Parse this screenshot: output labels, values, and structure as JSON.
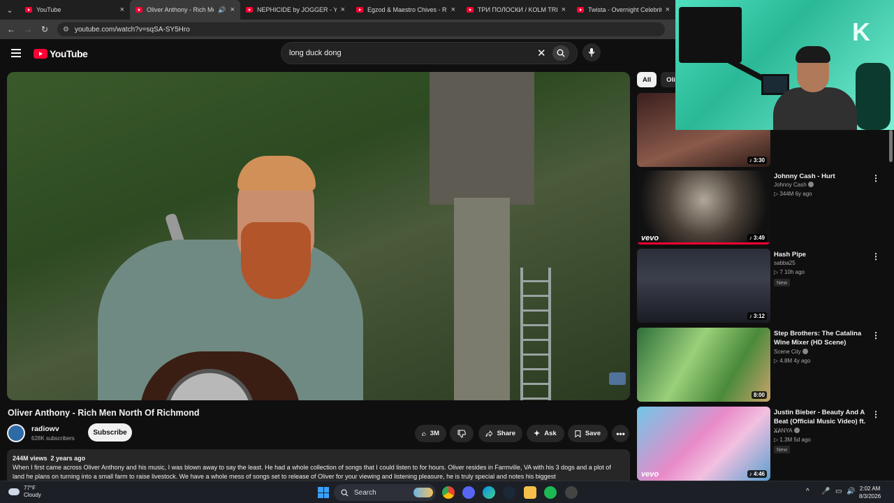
{
  "browser": {
    "tabs": [
      {
        "title": "YouTube",
        "active": false
      },
      {
        "title": "Oliver Anthony - Rich Men",
        "active": true
      },
      {
        "title": "NEPHICIDE by JOGGER - YouTu",
        "active": false
      },
      {
        "title": "Egzod & Maestro Chives - Roya",
        "active": false
      },
      {
        "title": "ТРИ ПОЛОСКИ / KOLM TRIIPU",
        "active": false
      },
      {
        "title": "Twista - Overnight Celebrity (O",
        "active": false
      }
    ],
    "url": "youtube.com/watch?v=sqSA-SY5Hro"
  },
  "youtube": {
    "logo_text": "YouTube",
    "search_value": "long duck dong",
    "video": {
      "title": "Oliver Anthony - Rich Men North Of Richmond",
      "channel": "radiowv",
      "subscribers": "628K subscribers",
      "subscribe_label": "Subscribe",
      "likes": "3M",
      "share_label": "Share",
      "ask_label": "Ask",
      "save_label": "Save",
      "views": "244M views",
      "age": "2 years ago",
      "description": "When I first came across Oliver Anthony and his music, I was blown away to say the least.  He had a whole collection of songs that I could listen to for hours.  Oliver resides in Farmville, VA with his 3 dogs and a plot of land he plans on turning into a small farm to raise livestock.  We have a whole mess of songs set to release of Oliver for your viewing and listening pleasure, he is truly special and notes his biggest"
    },
    "chips": [
      {
        "label": "All",
        "selected": true
      },
      {
        "label": "Oliv",
        "selected": false
      }
    ],
    "recommendations": [
      {
        "title": "",
        "channel": "",
        "stats": "",
        "duration": "3:30",
        "badge": ""
      },
      {
        "title": "Johnny Cash - Hurt",
        "channel": "Johnny Cash",
        "stats": "344M  6y ago",
        "duration": "3:49",
        "badge": "",
        "vevo": "vevo",
        "progress": 1.0
      },
      {
        "title": "Hash Pipe",
        "channel": "sabba25",
        "stats": "7  10h ago",
        "duration": "3:12",
        "badge": "New"
      },
      {
        "title": "Step Brothers: The Catalina Wine Mixer (HD Scene)",
        "channel": "Scene City",
        "stats": "4.8M  4y ago",
        "duration": "8:00",
        "badge": ""
      },
      {
        "title": "Justin Bieber - Beauty And A Beat (Official Music Video) ft. ...",
        "channel": "XANYA",
        "stats": "1.3M  5d ago",
        "duration": "4:46",
        "badge": "New",
        "vevo": "vevo"
      }
    ]
  },
  "webcam": {
    "letter": "K"
  },
  "taskbar": {
    "temperature": "77°F",
    "weather": "Cloudy",
    "search_label": "Search",
    "time": "2:02 AM",
    "date": "8/3/2026"
  },
  "colors": {
    "brand_red": "#ff0033",
    "background": "#0f0f0f",
    "chip_bg": "#272727"
  }
}
